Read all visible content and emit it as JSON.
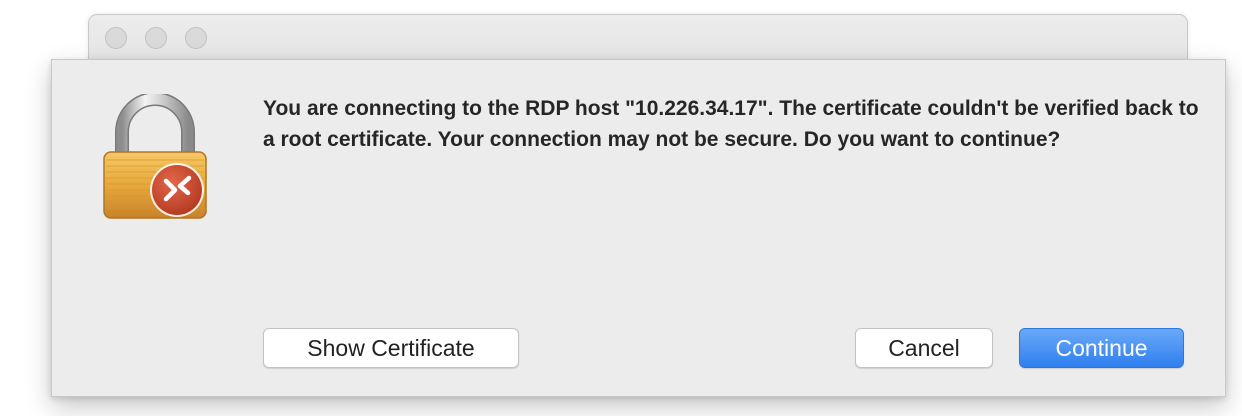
{
  "window": {
    "traffic_lights": [
      "close",
      "minimize",
      "zoom"
    ]
  },
  "dialog": {
    "icon": "lock-rdp-icon",
    "message": "You are connecting to the RDP host \"10.226.34.17\". The certificate couldn't be verified back to a root certificate. Your connection may not be secure. Do you want to continue?",
    "buttons": {
      "show_certificate": "Show Certificate",
      "cancel": "Cancel",
      "continue": "Continue"
    }
  },
  "colors": {
    "accent": "#2f7ff0",
    "sheet_bg": "#ececec",
    "badge": "#c8452c",
    "lock_body": "#e8a93a"
  }
}
